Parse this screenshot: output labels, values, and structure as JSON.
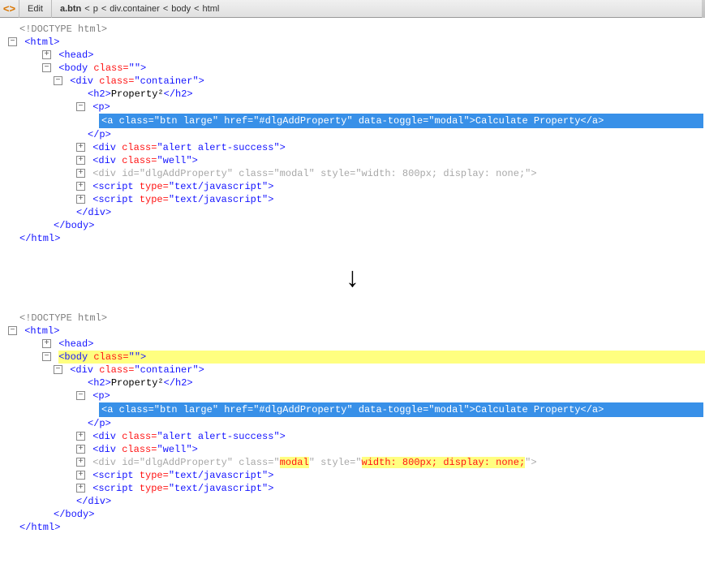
{
  "toolbar": {
    "edit": "Edit",
    "crumb_a_btn": "a.btn",
    "crumb_sep": "<",
    "crumb_p": "p",
    "crumb_div": "div.container",
    "crumb_body": "body",
    "crumb_html": "html"
  },
  "syntax": {
    "doctype": "<!DOCTYPE html>",
    "html_open": "<html>",
    "html_close": "</html>",
    "head": "<head>",
    "body_open_pre": "<body ",
    "body_open_attr": "class=",
    "body_open_val": "\"\"",
    "body_open_post": ">",
    "body_close": "</body>",
    "div_container_pre": "<div ",
    "div_container_attr": "class=",
    "div_container_val": "\"container\"",
    "div_container_post": ">",
    "div_close": "</div>",
    "h2_open": "<h2>",
    "h2_text": "Property²",
    "h2_close": "</h2>",
    "p_open": "<p>",
    "p_close": "</p>",
    "a_line": "<a class=\"btn large\" href=\"#dlgAddProperty\" data-toggle=\"modal\">Calculate Property</a>",
    "div_alert_pre": "<div ",
    "div_alert_attr": "class=",
    "div_alert_val": "\"alert alert-success\"",
    "div_alert_post": ">",
    "div_well_pre": "<div ",
    "div_well_attr": "class=",
    "div_well_val": "\"well\"",
    "div_well_post": ">",
    "div_modal_pre": "<div ",
    "div_modal_id_attr": "id=",
    "div_modal_id_val": "\"dlgAddProperty\"",
    "div_modal_class_attr": "class=",
    "div_modal_class_val": "\"modal\"",
    "div_modal_style_attr": "style=",
    "div_modal_style_val": "\"width: 800px; display: none;\"",
    "div_modal_post": ">",
    "script1_pre": "<script ",
    "script1_attr": "type=",
    "script1_val": "\"text/javascript\"",
    "script1_post": ">"
  },
  "highlights": {
    "modal_word": "modal",
    "style_inner": "width: 800px; display: none;"
  }
}
